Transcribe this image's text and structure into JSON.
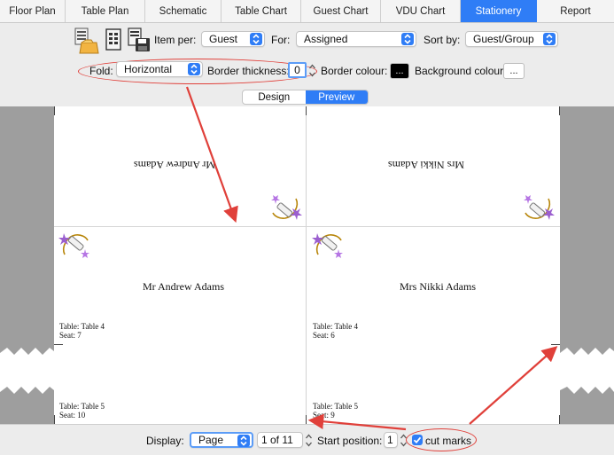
{
  "tabs": [
    {
      "label": "Floor Plan",
      "active": false
    },
    {
      "label": "Table Plan",
      "active": false
    },
    {
      "label": "Schematic",
      "active": false
    },
    {
      "label": "Table Chart",
      "active": false
    },
    {
      "label": "Guest Chart",
      "active": false
    },
    {
      "label": "VDU Chart",
      "active": false
    },
    {
      "label": "Stationery",
      "active": true
    },
    {
      "label": "Report",
      "active": false
    }
  ],
  "toolbar": {
    "item_per_label": "Item per:",
    "item_per_value": "Guest",
    "for_label": "For:",
    "for_value": "Assigned",
    "sort_by_label": "Sort by:",
    "sort_by_value": "Guest/Group",
    "fold_label": "Fold:",
    "fold_value": "Horizontal",
    "border_thickness_label": "Border thickness:",
    "border_thickness_value": "0",
    "border_colour_label": "Border colour:",
    "border_colour_button": "...",
    "background_colour_label": "Background colour:",
    "background_colour_button": "..."
  },
  "view_modes": {
    "design": "Design",
    "preview": "Preview",
    "active": "Preview"
  },
  "cards": [
    {
      "name_upside_down": "Mr Andrew Adams",
      "name": "Mr Andrew Adams",
      "table": "Table: Table 4",
      "seat": "Seat: 7"
    },
    {
      "name_upside_down": "Mrs Nikki Adams",
      "name": "Mrs Nikki Adams",
      "table": "Table: Table 4",
      "seat": "Seat: 6"
    },
    {
      "table": "Table: Table 5",
      "seat": "Seat: 10"
    },
    {
      "table": "Table: Table 5",
      "seat": "Seat: 9"
    }
  ],
  "bottom": {
    "display_label": "Display:",
    "display_value": "Page",
    "page_value": "1 of 11",
    "start_position_label": "Start position:",
    "start_position_value": "1",
    "cut_marks_label": "cut marks",
    "cut_marks_checked": true
  },
  "colors": {
    "accent": "#2f7df6",
    "annotation": "#e0403a",
    "border_colour_swatch": "#000000"
  },
  "icons": [
    "stationery-cards-icon",
    "stationery-page-icon",
    "stationery-save-icon",
    "wedding-favour-icon"
  ]
}
